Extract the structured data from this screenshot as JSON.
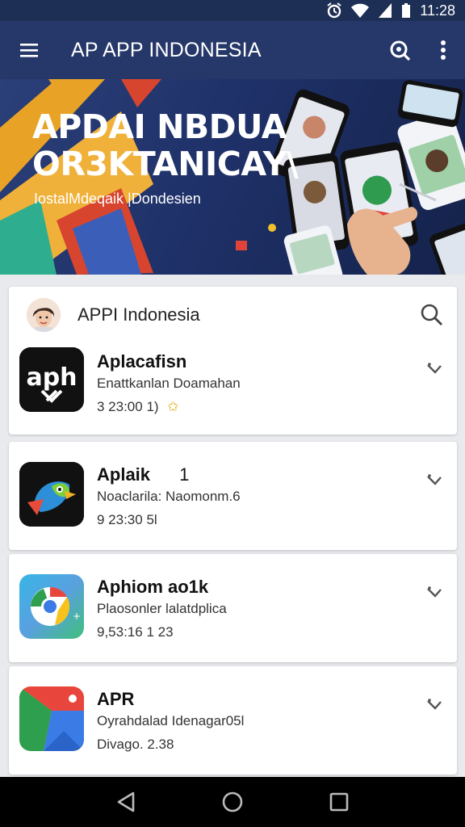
{
  "status": {
    "time": "11:28"
  },
  "toolbar": {
    "title": "AP APP INDONESIA"
  },
  "banner": {
    "headline_line1": "APDAI NBDUA",
    "headline_line2": "OR3KTANICAY\\",
    "subtitle": "IostalMdeqaik |Dondesien"
  },
  "list_header": {
    "title": "APPI Indonesia"
  },
  "apps": [
    {
      "name": "Aplacafisn",
      "desc": "Enattkanlan Doamahan",
      "meta": "3 23:00 1)",
      "badge": "✩"
    },
    {
      "name": "Aplaik",
      "name_suffix": "1",
      "desc": "Noaclarila: Naomonm.6",
      "meta": "9 23:30 5l"
    },
    {
      "name": "Aphiom ao1k",
      "desc": "Plaosonler lalatdplica",
      "meta": "9,53:16 1 23"
    },
    {
      "name": "APR",
      "desc": "Oyrahdalad Idenagar05l",
      "meta": "Divago. 2.38"
    }
  ],
  "colors": {
    "statusbar": "#1e2f55",
    "appbar": "#26386a",
    "accent_badge": "#e0a800"
  }
}
